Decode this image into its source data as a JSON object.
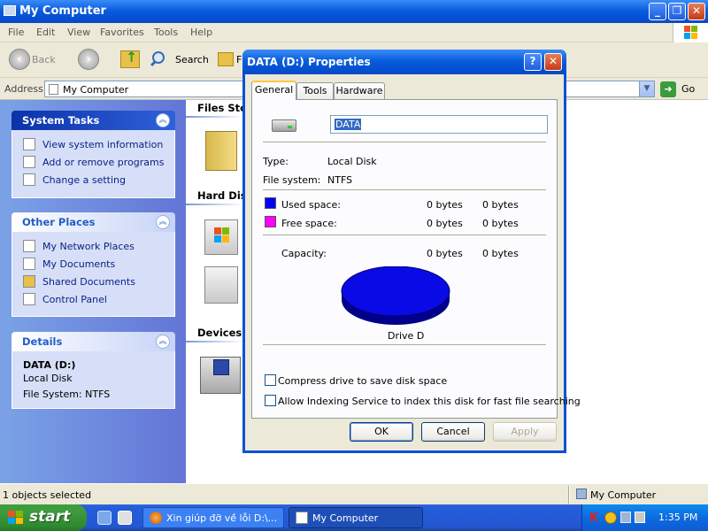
{
  "window": {
    "title": "My Computer",
    "menu": [
      "File",
      "Edit",
      "View",
      "Favorites",
      "Tools",
      "Help"
    ],
    "toolbar": {
      "back": "Back",
      "search": "Search",
      "folders_partial": "F"
    },
    "address": {
      "label": "Address",
      "value": "My Computer",
      "go": "Go"
    }
  },
  "left_panel": {
    "system_tasks": {
      "title": "System Tasks",
      "items": [
        "View system information",
        "Add or remove programs",
        "Change a setting"
      ]
    },
    "other_places": {
      "title": "Other Places",
      "items": [
        "My Network Places",
        "My Documents",
        "Shared Documents",
        "Control Panel"
      ]
    },
    "details": {
      "title": "Details",
      "name": "DATA (D:)",
      "type": "Local Disk",
      "filesystem": "File System: NTFS"
    }
  },
  "right_pane": {
    "groups": [
      "Files Stor",
      "Hard Disk",
      "Devices w"
    ]
  },
  "statusbar": {
    "left": "1 objects selected",
    "right": "My Computer"
  },
  "taskbar": {
    "start": "start",
    "tasks": [
      "Xin giúp đỡ về lỗi D:\\...",
      "My Computer"
    ],
    "clock": "1:35 PM"
  },
  "dialog": {
    "title": "DATA (D:) Properties",
    "tabs": [
      "General",
      "Tools",
      "Hardware"
    ],
    "name_value": "DATA",
    "type_label": "Type:",
    "type_value": "Local Disk",
    "fs_label": "File system:",
    "fs_value": "NTFS",
    "used_label": "Used space:",
    "used_bytes": "0 bytes",
    "used_size": "0 bytes",
    "free_label": "Free space:",
    "free_bytes": "0 bytes",
    "free_size": "0 bytes",
    "capacity_label": "Capacity:",
    "capacity_bytes": "0 bytes",
    "capacity_size": "0 bytes",
    "drive_label": "Drive D",
    "compress_label": "Compress drive to save disk space",
    "index_label": "Allow Indexing Service to index this disk for fast file searching",
    "ok": "OK",
    "cancel": "Cancel",
    "apply": "Apply",
    "colors": {
      "used": "#0000FF",
      "free": "#FF00FF",
      "pie": "#0A0AE6"
    }
  }
}
